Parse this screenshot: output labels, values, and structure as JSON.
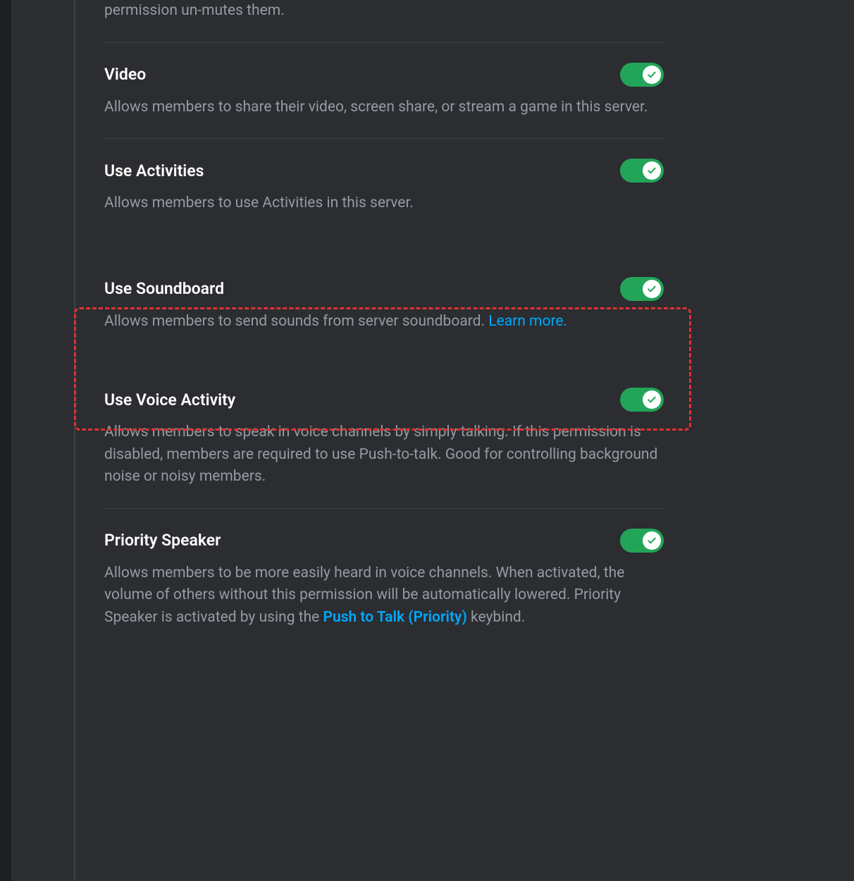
{
  "fragment": "permission un-mutes them.",
  "permissions": [
    {
      "title": "Video",
      "description": "Allows members to share their video, screen share, or stream a game in this server.",
      "enabled": true
    },
    {
      "title": "Use Activities",
      "description": "Allows members to use Activities in this server.",
      "enabled": true,
      "noBottomBorder": true
    },
    {
      "title": "Use Soundboard",
      "description": "Allows members to send sounds from server soundboard. ",
      "link": "Learn more.",
      "enabled": true,
      "noBorder": true
    },
    {
      "title": "Use Voice Activity",
      "description": "Allows members to speak in voice channels by simply talking. If this permission is disabled, members are required to use Push-to-talk. Good for controlling background noise or noisy members.",
      "enabled": true,
      "noBorder": true
    },
    {
      "title": "Priority Speaker",
      "descriptionPre": "Allows members to be more easily heard in voice channels. When activated, the volume of others without this permission will be automatically lowered. Priority Speaker is activated by using the ",
      "link": "Push to Talk (Priority)",
      "descriptionPost": " keybind.",
      "enabled": true
    }
  ]
}
